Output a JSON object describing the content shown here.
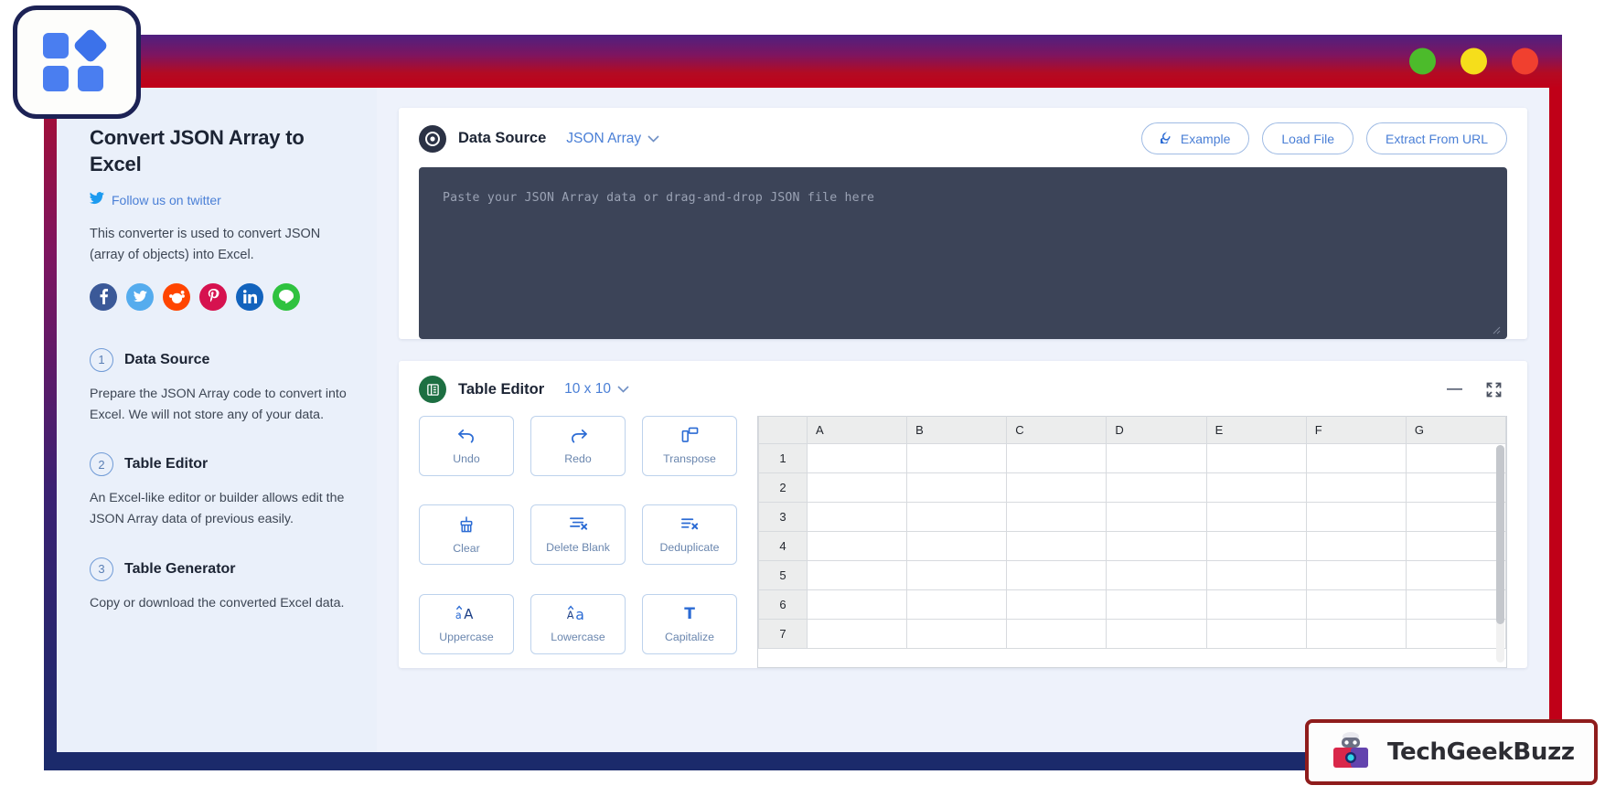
{
  "window": {
    "traffic_lights": [
      {
        "name": "minimize",
        "color": "#4cbb2b"
      },
      {
        "name": "maximize",
        "color": "#f5de1b"
      },
      {
        "name": "close",
        "color": "#f0402f"
      }
    ]
  },
  "sidebar": {
    "title": "Convert JSON Array to Excel",
    "twitter_label": "Follow us on twitter",
    "intro": "This converter is used to convert JSON (array of objects) into Excel.",
    "social": [
      {
        "name": "facebook",
        "glyph": "f",
        "color": "#3b5998"
      },
      {
        "name": "twitter",
        "glyph": "🐦",
        "color": "#55acee"
      },
      {
        "name": "reddit",
        "glyph": "ⓡ",
        "color": "#ff4500"
      },
      {
        "name": "pinterest",
        "glyph": "𝑷",
        "color": "#d6124f"
      },
      {
        "name": "linkedin",
        "glyph": "in",
        "color": "#1263bd"
      },
      {
        "name": "line",
        "glyph": "💬",
        "color": "#2fc23f"
      }
    ],
    "steps": [
      {
        "num": "1",
        "title": "Data Source",
        "body": "Prepare the JSON Array code to convert into Excel. We will not store any of your data."
      },
      {
        "num": "2",
        "title": "Table Editor",
        "body": "An Excel-like editor or builder allows edit the JSON Array data of previous easily."
      },
      {
        "num": "3",
        "title": "Table Generator",
        "body": "Copy or download the converted Excel data."
      }
    ]
  },
  "data_source": {
    "title": "Data Source",
    "format_value": "JSON Array",
    "chevron": "⌄",
    "buttons": [
      {
        "name": "example",
        "label": "Example",
        "icon": "refresh-icon"
      },
      {
        "name": "load-file",
        "label": "Load File",
        "icon": ""
      },
      {
        "name": "extract-from-url",
        "label": "Extract From URL",
        "icon": ""
      }
    ],
    "textarea_placeholder": "Paste your JSON Array data or drag-and-drop JSON file here",
    "textarea_value": ""
  },
  "table_editor": {
    "title": "Table Editor",
    "size_value": "10 x 10",
    "chevron": "⌄",
    "minimize_glyph": "−",
    "expand_glyph": "⛶",
    "tools": [
      {
        "name": "undo",
        "label": "Undo",
        "glyph": "↶"
      },
      {
        "name": "redo",
        "label": "Redo",
        "glyph": "↷"
      },
      {
        "name": "transpose",
        "label": "Transpose",
        "glyph": "❐"
      },
      {
        "name": "clear",
        "label": "Clear",
        "glyph": "⌧"
      },
      {
        "name": "delete-blank",
        "label": "Delete Blank",
        "glyph": "≡"
      },
      {
        "name": "deduplicate",
        "label": "Deduplicate",
        "glyph": "≣"
      },
      {
        "name": "uppercase",
        "label": "Uppercase",
        "glyph": "aA"
      },
      {
        "name": "lowercase",
        "label": "Lowercase",
        "glyph": "Aa"
      },
      {
        "name": "capitalize",
        "label": "Capitalize",
        "glyph": "T"
      }
    ],
    "sheet": {
      "columns": [
        "A",
        "B",
        "C",
        "D",
        "E",
        "F",
        "G"
      ],
      "rows": [
        "1",
        "2",
        "3",
        "4",
        "5",
        "6",
        "7"
      ],
      "cells": [
        [
          "",
          "",
          "",
          "",
          "",
          "",
          ""
        ],
        [
          "",
          "",
          "",
          "",
          "",
          "",
          ""
        ],
        [
          "",
          "",
          "",
          "",
          "",
          "",
          ""
        ],
        [
          "",
          "",
          "",
          "",
          "",
          "",
          ""
        ],
        [
          "",
          "",
          "",
          "",
          "",
          "",
          ""
        ],
        [
          "",
          "",
          "",
          "",
          "",
          "",
          ""
        ],
        [
          "",
          "",
          "",
          "",
          "",
          "",
          ""
        ]
      ]
    }
  },
  "watermark": {
    "text": "TechGeekBuzz"
  }
}
